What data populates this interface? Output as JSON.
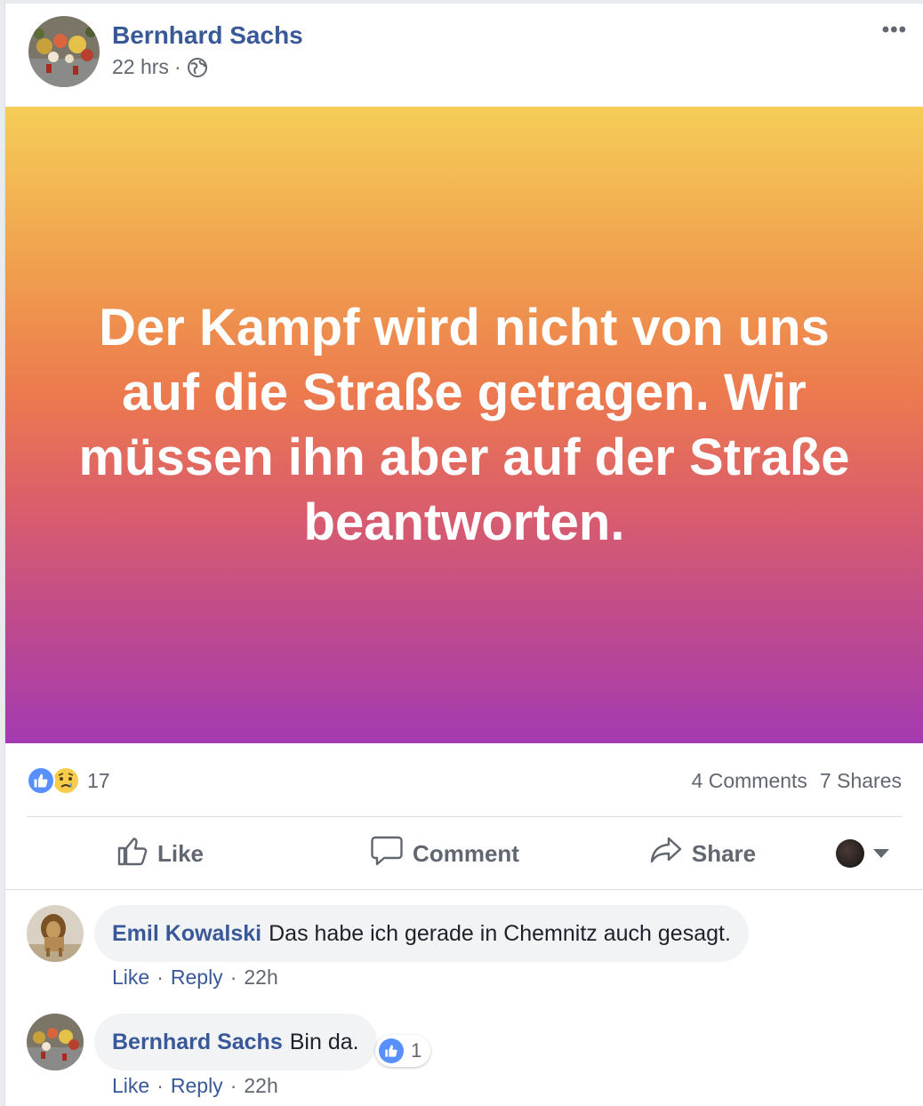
{
  "post": {
    "author": "Bernhard Sachs",
    "time": "22 hrs",
    "dot": "·",
    "more": "•••",
    "banner_text": "Der Kampf wird nicht von uns auf die Straße getragen. Wir müssen ihn aber auf der Straße beantworten.",
    "banner_colors": [
      "#f6cd58",
      "#ec7a4e",
      "#a43ab1"
    ]
  },
  "stats": {
    "reaction_count": "17",
    "comments": "4 Comments",
    "shares": "7 Shares"
  },
  "actions": {
    "like": "Like",
    "comment": "Comment",
    "share": "Share"
  },
  "comments": [
    {
      "author": "Emil Kowalski",
      "text": "Das habe ich gerade in Chemnitz auch gesagt.",
      "like": "Like",
      "reply": "Reply",
      "time": "22h"
    },
    {
      "author": "Bernhard Sachs",
      "text": "Bin da.",
      "like": "Like",
      "reply": "Reply",
      "time": "22h",
      "reaction_count": "1"
    }
  ],
  "separator": "·",
  "colors": {
    "link": "#385898",
    "muted": "#606770",
    "like_blue": "#5890ff"
  }
}
